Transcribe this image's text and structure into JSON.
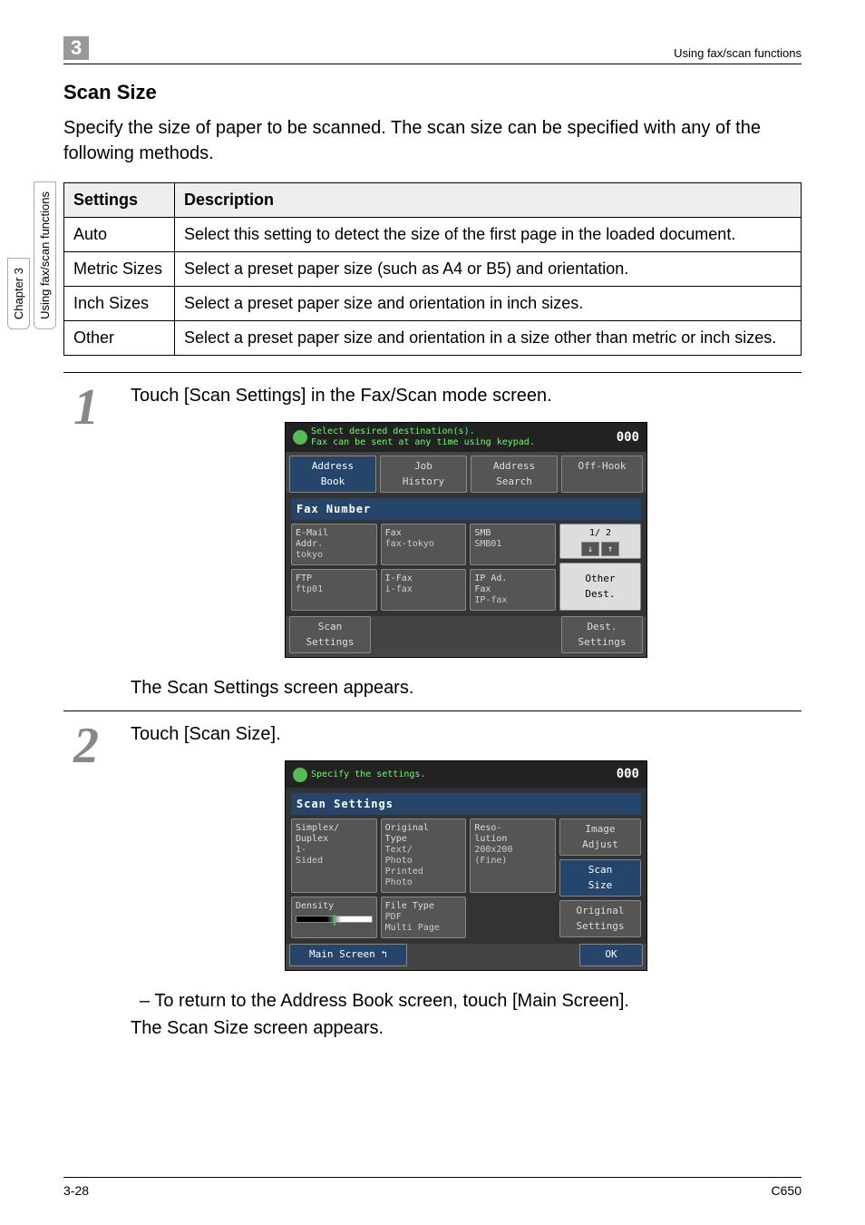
{
  "header": {
    "chapter_num": "3",
    "right_text": "Using fax/scan functions"
  },
  "sidetabs": {
    "chapter": "Chapter 3",
    "functions": "Using fax/scan functions"
  },
  "section": {
    "title": "Scan Size",
    "intro": "Specify the size of paper to be scanned. The scan size can be specified with any of the following methods."
  },
  "table": {
    "headers": [
      "Settings",
      "Description"
    ],
    "rows": [
      {
        "s": "Auto",
        "d": "Select this setting to detect the size of the first page in the loaded document."
      },
      {
        "s": "Metric Sizes",
        "d": "Select a preset paper size (such as A4 or B5) and orientation."
      },
      {
        "s": "Inch Sizes",
        "d": "Select a preset paper size and orientation in inch sizes."
      },
      {
        "s": "Other",
        "d": "Select a preset paper size and orientation in a size other than metric or inch sizes."
      }
    ]
  },
  "steps": {
    "s1": {
      "num": "1",
      "text": "Touch [Scan Settings] in the Fax/Scan mode screen.",
      "after": "The Scan Settings screen appears."
    },
    "s2": {
      "num": "2",
      "text": "Touch [Scan Size].",
      "bullet": "–  To return to the Address Book screen, touch [Main Screen].",
      "after": "The Scan Size screen appears."
    }
  },
  "lcd1": {
    "msg1": "Select desired destination(s).",
    "msg2": "Fax can be sent at any time using keypad.",
    "count": "000",
    "tabs": {
      "a": "Address\nBook",
      "b": "Job\nHistory",
      "c": "Address\nSearch",
      "off": "Off-Hook"
    },
    "faxnum": "Fax Number",
    "cells": {
      "c1a": "E-Mail\nAddr.",
      "c1b": "tokyo",
      "c2a": "Fax",
      "c2b": "fax-tokyo",
      "c3a": "SMB",
      "c3b": "SMB01",
      "c4a": "FTP",
      "c4b": "ftp01",
      "c5a": "I-Fax",
      "c5b": "i-fax",
      "c6a": "IP Ad.\nFax",
      "c6b": "IP-fax"
    },
    "pager": "1/  2",
    "other": "Other\nDest.",
    "footer": {
      "scan": "Scan\nSettings",
      "dest": "Dest.\nSettings"
    }
  },
  "lcd2": {
    "msg": "Specify the settings.",
    "count": "000",
    "title": "Scan Settings",
    "cells": {
      "a1": "Simplex/\nDuplex",
      "a1b": "1-\nSided",
      "b1": "Original\nType",
      "b1b": "Text/\nPhoto",
      "b1c": "Printed\nPhoto",
      "c1": "Reso-\nlution",
      "c1b": "200x200\n(Fine)",
      "a2": "Density",
      "b2": "File Type",
      "b2b": "PDF\nMulti Page"
    },
    "side": {
      "img": "Image\nAdjust",
      "scan": "Scan\nSize",
      "orig": "Original\nSettings"
    },
    "footer": {
      "main": "Main Screen ↰",
      "ok": "OK"
    }
  },
  "footer": {
    "left": "3-28",
    "right": "C650"
  }
}
